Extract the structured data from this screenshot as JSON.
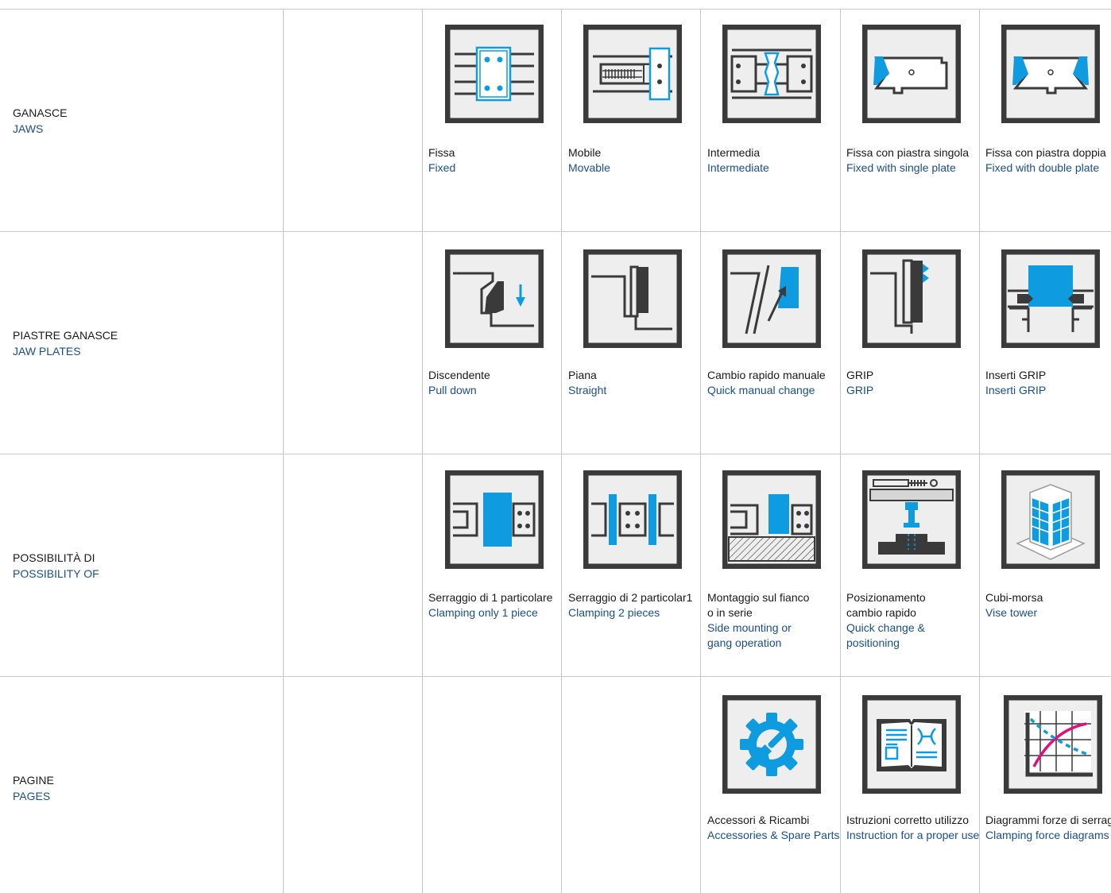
{
  "rows": [
    {
      "label_it": "GANASCE",
      "label_en": "JAWS",
      "items": [
        {
          "it": "Fissa",
          "en": "Fixed",
          "icon": "fixed-jaw-icon"
        },
        {
          "it": "Mobile",
          "en": "Movable",
          "icon": "movable-jaw-icon"
        },
        {
          "it": "Intermedia",
          "en": "Intermediate",
          "icon": "intermediate-jaw-icon"
        },
        {
          "it": "Fissa con piastra singola",
          "en": "Fixed with single plate",
          "icon": "single-plate-jaw-icon"
        },
        {
          "it": "Fissa con piastra doppia",
          "en": "Fixed with double plate",
          "icon": "double-plate-jaw-icon"
        }
      ]
    },
    {
      "label_it": "PIASTRE GANASCE",
      "label_en": "JAW PLATES",
      "items": [
        {
          "it": "Discendente",
          "en": "Pull down",
          "icon": "pull-down-plate-icon"
        },
        {
          "it": "Piana",
          "en": "Straight",
          "icon": "straight-plate-icon"
        },
        {
          "it": "Cambio rapido manuale",
          "en": "Quick manual change",
          "icon": "quick-change-plate-icon"
        },
        {
          "it": "GRIP",
          "en": "GRIP",
          "icon": "grip-plate-icon"
        },
        {
          "it": "Inserti GRIP",
          "en": "Inserti GRIP",
          "icon": "grip-inserts-icon"
        }
      ]
    },
    {
      "label_it": "POSSIBILITÀ DI",
      "label_en": "POSSIBILITY OF",
      "items": [
        {
          "it": "Serraggio di 1 particolare",
          "en": "Clamping only 1 piece",
          "icon": "clamp-one-piece-icon"
        },
        {
          "it": "Serraggio di 2 particolar1",
          "en": "Clamping 2 pieces",
          "icon": "clamp-two-pieces-icon"
        },
        {
          "it": "Montaggio sul fianco\no in serie",
          "en": "Side mounting or\ngang operation",
          "icon": "side-mounting-icon"
        },
        {
          "it": "Posizionamento\ncambio rapido",
          "en": "Quick change &\npositioning",
          "icon": "quick-positioning-icon"
        },
        {
          "it": "Cubi-morsa",
          "en": "Vise tower",
          "icon": "vise-tower-icon"
        }
      ]
    },
    {
      "label_it": "PAGINE",
      "label_en": "PAGES",
      "items": [
        {
          "it": "Accessori & Ricambi",
          "en": "Accessories & Spare Parts",
          "icon": "gear-wrench-icon"
        },
        {
          "it": "Istruzioni corretto utilizzo",
          "en": "Instruction for a proper use",
          "icon": "manual-book-icon"
        },
        {
          "it": "Diagrammi forze di serraggio",
          "en": "Clamping force diagrams",
          "icon": "force-chart-icon"
        }
      ]
    }
  ],
  "colors": {
    "accent": "#0f9be0",
    "text_en": "#1b4f8a",
    "frame": "#3a3a3a",
    "panel": "#eeeeee",
    "magenta": "#e0107a"
  }
}
